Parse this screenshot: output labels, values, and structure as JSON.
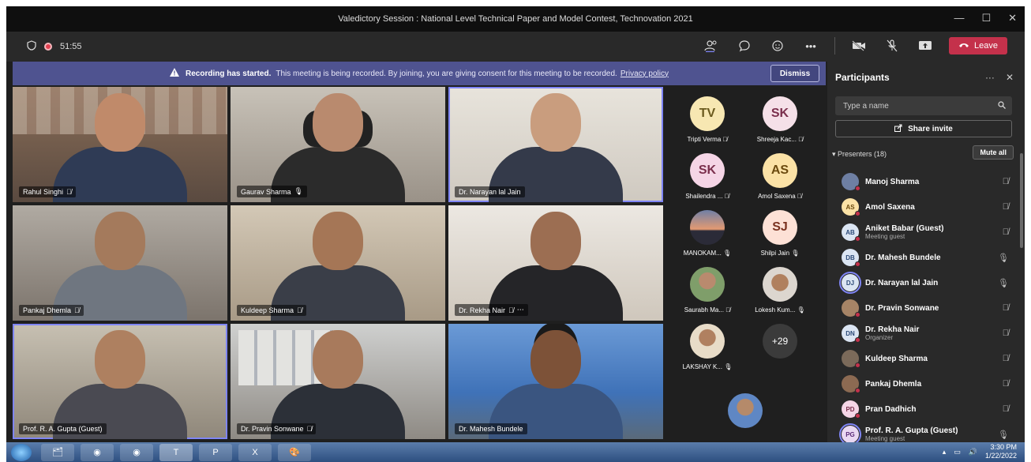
{
  "window": {
    "title": "Valedictory Session : National Level Technical Paper and Model Contest, Technovation 2021",
    "controls": [
      "—",
      "☐",
      "✕"
    ]
  },
  "meeting": {
    "timer": "51:55",
    "leave_label": "Leave"
  },
  "banner": {
    "bold": "Recording has started.",
    "text": "This meeting is being recorded. By joining, you are giving consent for this meeting to be recorded.",
    "link": "Privacy policy",
    "dismiss": "Dismiss"
  },
  "video_tiles": [
    {
      "name": "Rahul Singhi"
    },
    {
      "name": "Gaurav Sharma"
    },
    {
      "name": "Dr. Narayan lal Jain"
    },
    {
      "name": "Pankaj Dhemla"
    },
    {
      "name": "Kuldeep Sharma"
    },
    {
      "name": "Dr. Rekha Nair"
    },
    {
      "name": "Prof. R. A. Gupta (Guest)"
    },
    {
      "name": "Dr. Pravin Sonwane"
    },
    {
      "name": "Dr. Mahesh Bundele"
    }
  ],
  "strip": [
    {
      "initials": "TV",
      "name": "Tripti Verma"
    },
    {
      "initials": "SK",
      "name": "Shreeja Kac..."
    },
    {
      "initials": "SK",
      "name": "Shailendra ..."
    },
    {
      "initials": "AS",
      "name": "Amol Saxena"
    },
    {
      "initials": "",
      "name": "MANOKAM..."
    },
    {
      "initials": "SJ",
      "name": "Shilpi Jain"
    },
    {
      "initials": "",
      "name": "Saurabh Ma..."
    },
    {
      "initials": "",
      "name": "Lokesh Kum..."
    },
    {
      "initials": "",
      "name": "LAKSHAY K..."
    },
    {
      "initials": "+29",
      "name": ""
    }
  ],
  "panel": {
    "title": "Participants",
    "search_placeholder": "Type a name",
    "share_invite": "Share invite",
    "presenters_label": "Presenters (18)",
    "mute_all": "Mute all",
    "participants": [
      {
        "initials": "",
        "name": "Manoj Sharma",
        "sub": ""
      },
      {
        "initials": "AS",
        "name": "Amol Saxena",
        "sub": ""
      },
      {
        "initials": "AB",
        "name": "Aniket Babar (Guest)",
        "sub": "Meeting guest"
      },
      {
        "initials": "DB",
        "name": "Dr. Mahesh Bundele",
        "sub": ""
      },
      {
        "initials": "DJ",
        "name": "Dr. Narayan lal Jain",
        "sub": ""
      },
      {
        "initials": "",
        "name": "Dr. Pravin Sonwane",
        "sub": ""
      },
      {
        "initials": "DN",
        "name": "Dr. Rekha Nair",
        "sub": "Organizer"
      },
      {
        "initials": "",
        "name": "Kuldeep Sharma",
        "sub": ""
      },
      {
        "initials": "",
        "name": "Pankaj Dhemla",
        "sub": ""
      },
      {
        "initials": "PD",
        "name": "Pran Dadhich",
        "sub": ""
      },
      {
        "initials": "PG",
        "name": "Prof. R. A. Gupta (Guest)",
        "sub": "Meeting guest"
      }
    ]
  },
  "taskbar": {
    "time": "3:30 PM",
    "date": "1/22/2022"
  }
}
